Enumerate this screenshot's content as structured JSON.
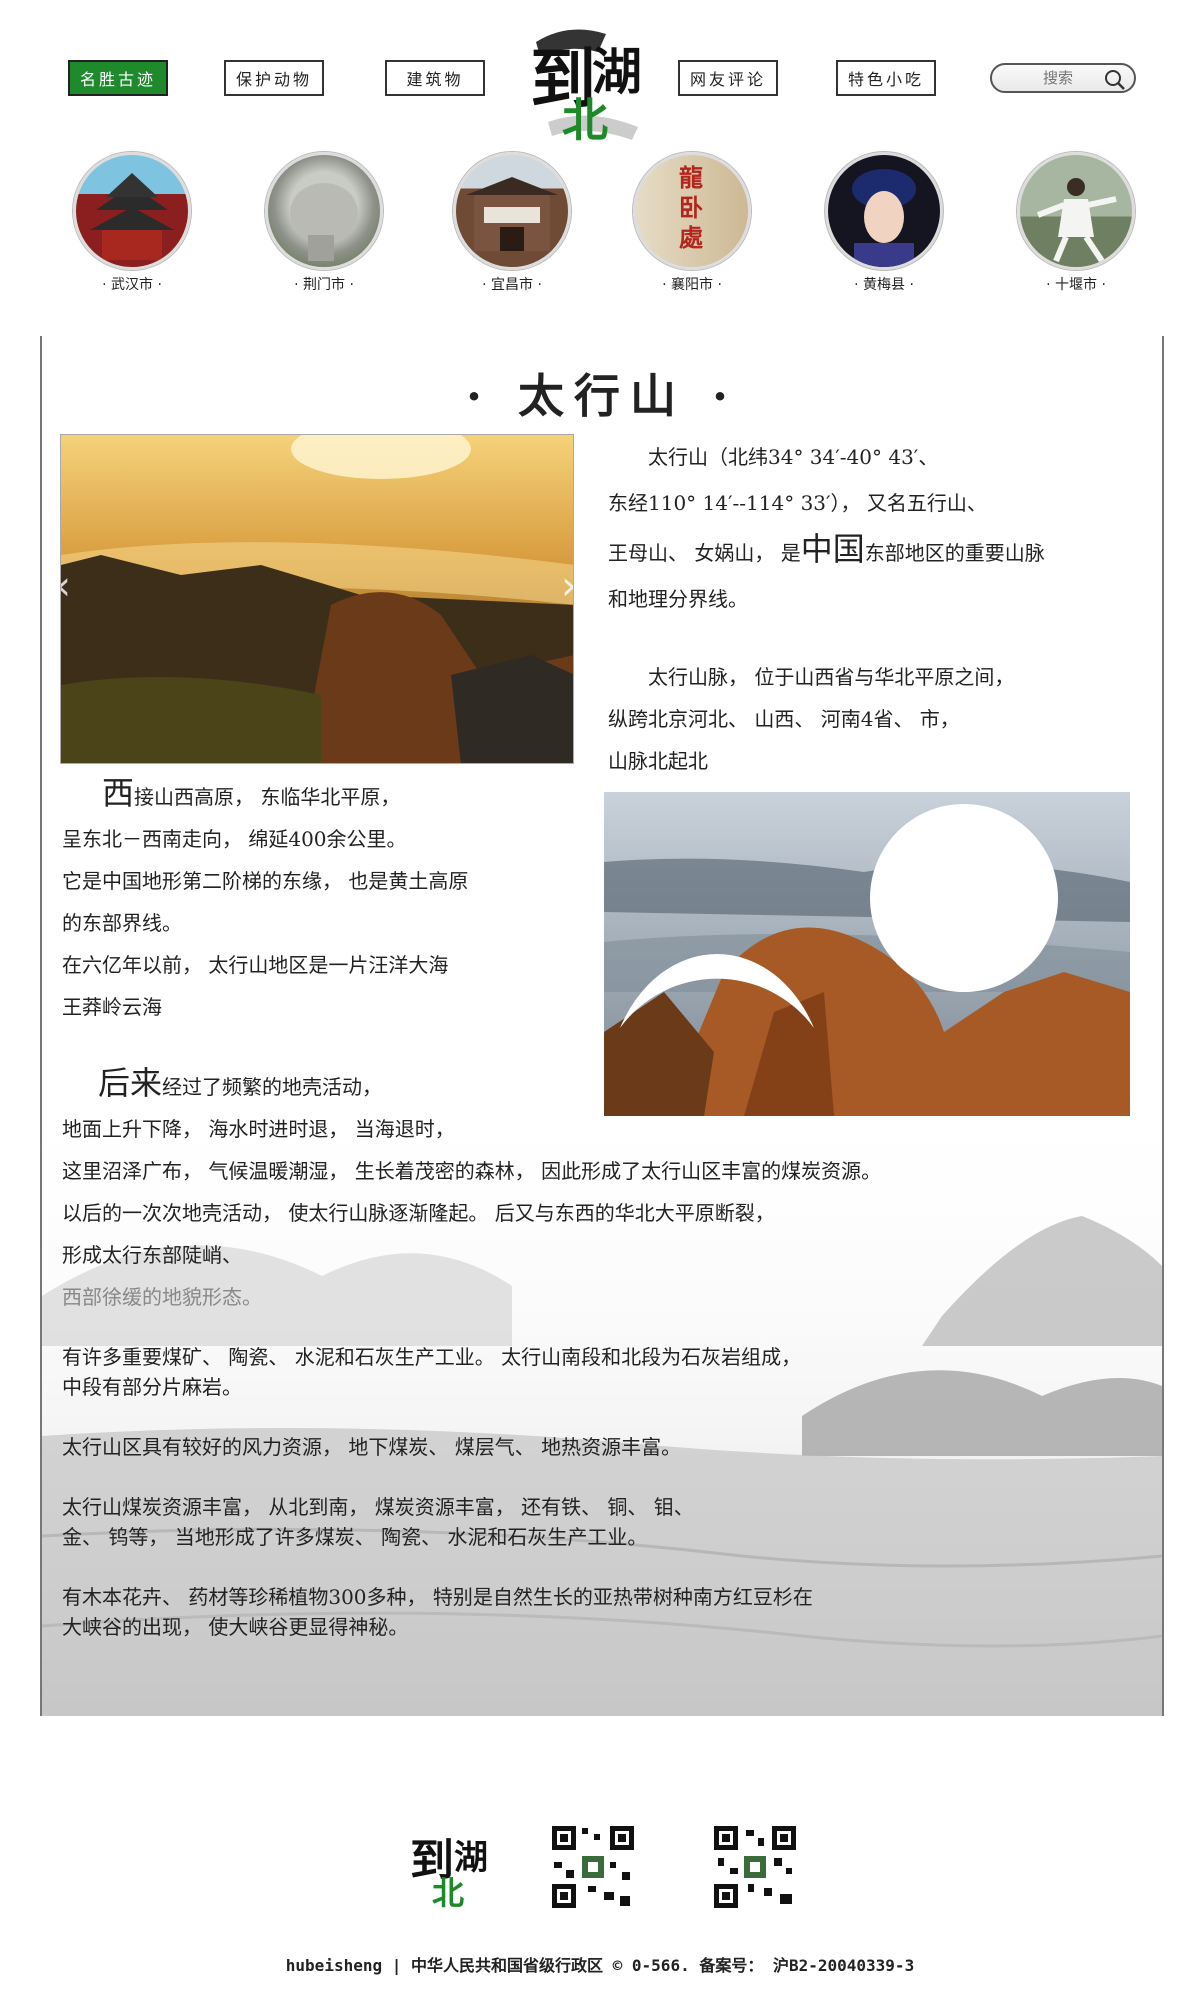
{
  "nav": {
    "items": [
      "名胜古迹",
      "保护动物",
      "建筑物",
      "网友评论",
      "特色小吃"
    ],
    "search_placeholder": "搜索"
  },
  "logo": {
    "char1": "到",
    "char2": "湖",
    "char3": "北"
  },
  "cities": [
    "· 武汉市 ·",
    "· 荆门市 ·",
    "· 宜昌市 ·",
    "· 襄阳市 ·",
    "· 黄梅县 ·",
    "· 十堰市 ·"
  ],
  "city_badge_text": "龍卧處",
  "article": {
    "title": "· 太行山 ·",
    "right_p1": [
      "太行山（北纬34° 34′-40° 43′、",
      "东经110° 14′--114° 33′）， 又名五行山、",
      "王母山、 女娲山， 是",
      "中国",
      "东部地区的重要山脉",
      "和地理分界线。"
    ],
    "right_p2": [
      "太行山脉， 位于山西省与华北平原之间，",
      "纵跨北京河北、 山西、 河南4省、 市，",
      "山脉北起北"
    ],
    "left_p1_big": "西",
    "left_p1": [
      "接山西高原， 东临华北平原，",
      "呈东北－西南走向， 绵延400余公里。",
      "它是中国地形第二阶梯的东缘， 也是黄土高原",
      "的东部界线。",
      "在六亿年以前， 太行山地区是一片汪洋大海",
      "王莽岭云海"
    ],
    "left_p2_big": "后来",
    "left_p2": [
      "经过了频繁的地壳活动，",
      "地面上升下降， 海水时进时退， 当海退时，",
      "这里沼泽广布， 气候温暖潮湿， 生长着茂密的森林， 因此形成了太行山区丰富的煤炭资源。",
      "以后的一次次地壳活动， 使太行山脉逐渐隆起。 后又与东西的华北大平原断裂，",
      "形成太行东部陡峭、",
      "西部徐缓的地貌形态。"
    ],
    "para3": [
      "有许多重要煤矿、 陶瓷、 水泥和石灰生产工业。 太行山南段和北段为石灰岩组成，",
      "中段有部分片麻岩。"
    ],
    "para4": "太行山区具有较好的风力资源， 地下煤炭、 煤层气、 地热资源丰富。",
    "para5": [
      "太行山煤炭资源丰富， 从北到南， 煤炭资源丰富， 还有铁、 铜、 钼、",
      "金、 钨等， 当地形成了许多煤炭、 陶瓷、 水泥和石灰生产工业。"
    ],
    "para6": [
      "有木本花卉、 药材等珍稀植物300多种， 特别是自然生长的亚热带树种南方红豆杉在",
      "大峡谷的出现， 使大峡谷更显得神秘。"
    ]
  },
  "slider": {
    "prev": "‹",
    "next": "›"
  },
  "footer": {
    "copyright": "hubeisheng | 中华人民共和国省级行政区 © 0-566. 备案号： 沪B2-20040339-3"
  }
}
